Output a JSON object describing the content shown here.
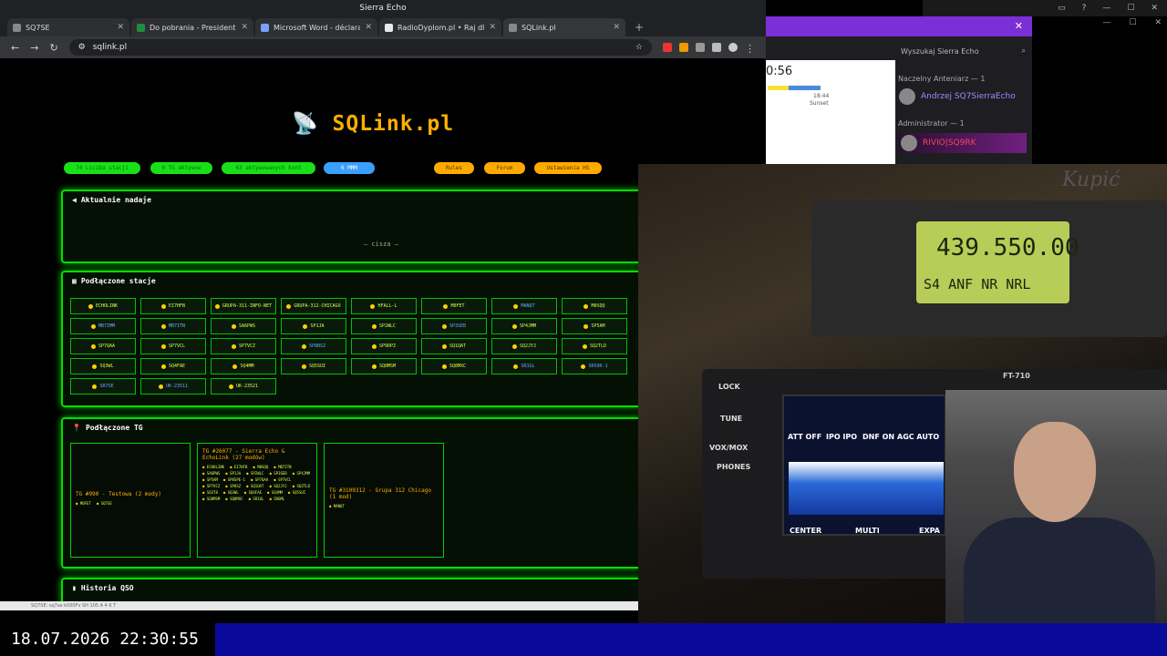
{
  "window_title": "Sierra Echo",
  "tabs": [
    {
      "label": "SQ7SE",
      "color": "#888888"
    },
    {
      "label": "Do pobrania - President",
      "color": "#1e8e3e"
    },
    {
      "label": "Microsoft Word - déclaration",
      "color": "#7aa0ff"
    },
    {
      "label": "RadioDyplom.pl • Raj dla krót",
      "color": "#e8eaed"
    },
    {
      "label": "SQLink.pl",
      "color": "#888888"
    }
  ],
  "address": "sqlink.pl",
  "logo_text": "SQLink.pl",
  "pills": {
    "green": [
      "74 Liczba stacji",
      "0 TG aktywne",
      "43 aktywowanych kont"
    ],
    "blue": "6 MMM",
    "orange": [
      "Rules",
      "Forum",
      "Ustawienia HS"
    ]
  },
  "panels": {
    "active_title": "Aktualnie nadaje",
    "silence": "— cisza —",
    "stations_title": "Podłączone stacje",
    "tg_title": "Podłączone TG",
    "history_title": "Historia QSO"
  },
  "stations": [
    "ECHOLINK",
    "EI7HFB",
    "GRUPA-311-INFO-NET",
    "GRUPA-312-CHICAGO",
    "HFALL-L",
    "M0FET",
    "MANQT",
    "M0SQQ",
    "MB7IMM",
    "MB7ITN",
    "SA6PWS",
    "SP1JA",
    "SP2WLC",
    "SP3SEB",
    "SP4JMM",
    "SP5AM",
    "SP7QAA",
    "SP7VCL",
    "SP7VCZ",
    "SP8BSZ",
    "SP9DPZ",
    "SQ1QAT",
    "SQ2JYJ",
    "SQ2TLD",
    "SQ3WL",
    "SQ4FAE",
    "SQ4MM",
    "SQ5SUI",
    "SQ8MSM",
    "SQ8MXC",
    "SR1GL",
    "SR5OK-1",
    "SR7SE",
    "UK-23511",
    "UK-23521"
  ],
  "tg_boxes": [
    {
      "title": "TG #990 - Testowa (2 mody)",
      "items": [
        "M0FET",
        "SQ7SE"
      ]
    },
    {
      "title": "TG #26077 - Sierra Echo & EchoLink (27 modów)",
      "items": [
        "ECHOLINK",
        "EI7HFB",
        "M0SQQ",
        "MB7ITN",
        "SA6PWS",
        "SP1JA",
        "SP2WLC",
        "SP3SEB",
        "SP4JMM",
        "SP5AM",
        "SP8SPE-1",
        "SP7QAA",
        "SP7VCL",
        "SP7VCZ",
        "SP8SZ",
        "SQ1QAT",
        "SQ2JYJ",
        "SQ2TLD",
        "SQ3T8",
        "SQ3WL",
        "SQ4FAE",
        "SQ4MM",
        "SQ5SUI",
        "SQ8MSM",
        "SQ8MXC",
        "SR1GL",
        "SR6ML"
      ]
    },
    {
      "title": "TG #3109312 - Grupa 312 Chicago (1 mod)",
      "items": [
        "MANQT"
      ]
    }
  ],
  "right_panel": {
    "search_placeholder": "Wyszukaj Sierra Echo",
    "clock_time": "0:56",
    "sunset_time": "18:44",
    "sunset_label": "Sunset",
    "role1": "Naczelny Anteniarz — 1",
    "user1": "Andrzej SQ7SierraEcho",
    "role2": "Administrator — 1",
    "user2": "RIVIO|SQ9RK"
  },
  "video": {
    "frequency": "439.550.00",
    "mode_line": "S4 ANF NR NRL",
    "handwritten": "Kupić",
    "radio_model": "FT-710",
    "ft710_labels": [
      "LOCK",
      "TUNE",
      "VOX/MOX",
      "PHONES",
      "CENTER",
      "MULTI",
      "EXPA"
    ],
    "lcd_labels": [
      "ATT OFF",
      "IPO IPO",
      "DNF ON",
      "AGC AUTO"
    ]
  },
  "taskbar_strip": "SQ7SE: sq7se k000Fv   SH 105 A 4 K T",
  "overlay_clock": "18.07.2026 22:30:55"
}
